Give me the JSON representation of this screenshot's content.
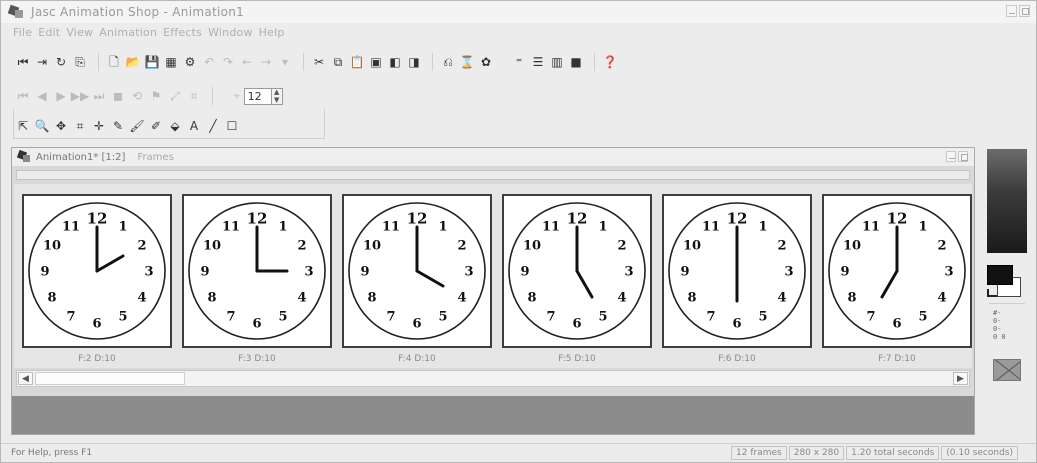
{
  "window": {
    "title": "Jasc Animation Shop - Animation1"
  },
  "menubar": {
    "items": [
      "File",
      "Edit",
      "View",
      "Animation",
      "Effects",
      "Window",
      "Help"
    ]
  },
  "toolbar": {
    "frame_spinner_value": "12"
  },
  "document": {
    "title": "Animation1* [1:2]",
    "subtitle": "Frames"
  },
  "frames": [
    {
      "label": "F:2  D:10",
      "hour": 2
    },
    {
      "label": "F:3  D:10",
      "hour": 3
    },
    {
      "label": "F:4  D:10",
      "hour": 4
    },
    {
      "label": "F:5  D:10",
      "hour": 5
    },
    {
      "label": "F:6  D:10",
      "hour": 6
    },
    {
      "label": "F:7  D:10",
      "hour": 7
    }
  ],
  "clock_numerals": [
    "12",
    "1",
    "2",
    "3",
    "4",
    "5",
    "6",
    "7",
    "8",
    "9",
    "10",
    "11"
  ],
  "palette": {
    "small_text": "#-\n0-\n0-\n0 0"
  },
  "statusbar": {
    "help": "For Help, press F1",
    "frames": "12 frames",
    "size": "280 x 280",
    "total": "1.20 total seconds",
    "per_frame": "(0.10 seconds)"
  }
}
